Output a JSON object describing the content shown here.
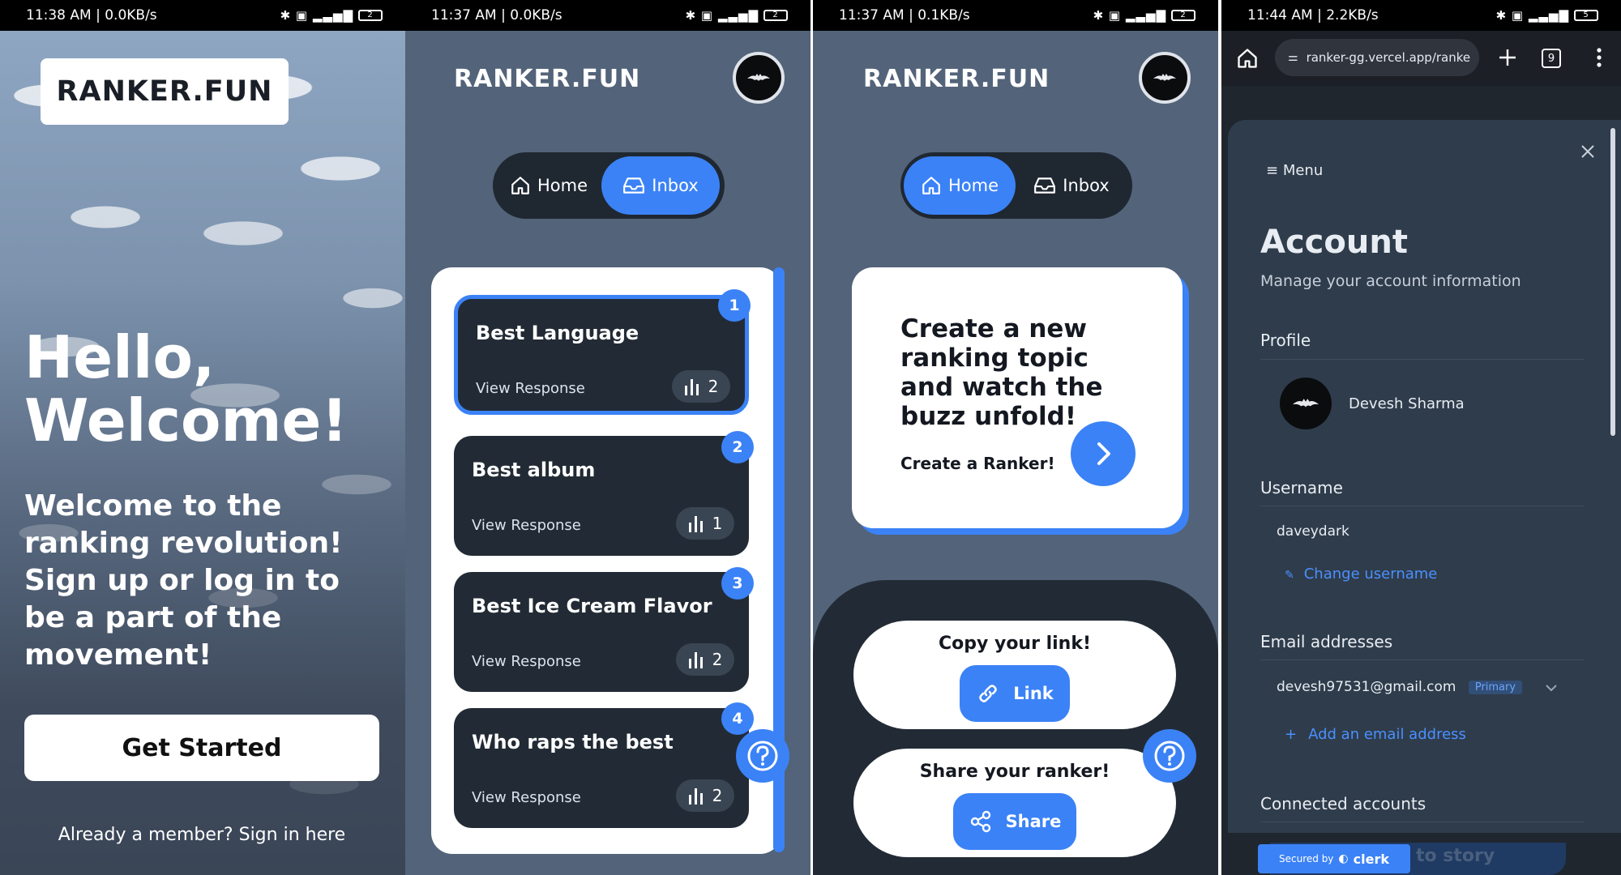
{
  "phone1": {
    "status": {
      "time": "11:38 AM | 0.0KB/s",
      "battery": "2"
    },
    "logo": "RANKER.FUN",
    "greeting": "Hello, Welcome!",
    "subtitle": "Welcome to the ranking revolution! Sign up or log in to be a part of the movement!",
    "cta": "Get Started",
    "signin": "Already a member? Sign in here"
  },
  "phone2": {
    "status": {
      "time": "11:37 AM | 0.0KB/s",
      "battery": "2"
    },
    "brand": "RANKER.FUN",
    "nav": {
      "home": "Home",
      "inbox": "Inbox",
      "active": "inbox"
    },
    "items": [
      {
        "title": "Best Language",
        "view": "View Response",
        "count": "2",
        "badge": "1"
      },
      {
        "title": "Best album",
        "view": "View Response",
        "count": "1",
        "badge": "2"
      },
      {
        "title": "Best Ice Cream Flavor",
        "view": "View Response",
        "count": "2",
        "badge": "3"
      },
      {
        "title": "Who raps the best",
        "view": "View Response",
        "count": "2",
        "badge": "4"
      }
    ]
  },
  "phone3": {
    "status": {
      "time": "11:37 AM | 0.1KB/s",
      "battery": "2"
    },
    "brand": "RANKER.FUN",
    "nav": {
      "home": "Home",
      "inbox": "Inbox",
      "active": "home"
    },
    "create": {
      "text": "Create a new ranking topic and watch the buzz unfold!",
      "cta": "Create a Ranker!"
    },
    "copy": {
      "title": "Copy your link!",
      "button": "Link"
    },
    "share": {
      "title": "Share your ranker!",
      "button": "Share"
    }
  },
  "phone4": {
    "status": {
      "time": "11:44 AM | 2.2KB/s",
      "battery": "5"
    },
    "browser": {
      "url": "ranker-gg.vercel.app/ranke",
      "tabs": "9"
    },
    "menu": "Menu",
    "title": "Account",
    "subtitle": "Manage your account information",
    "profile": {
      "label": "Profile",
      "name": "Devesh Sharma"
    },
    "username": {
      "label": "Username",
      "value": "daveydark",
      "change": "Change username"
    },
    "email": {
      "label": "Email addresses",
      "value": "devesh97531@gmail.com",
      "tag": "Primary",
      "add": "Add an email address"
    },
    "connected": "Connected accounts",
    "footer": {
      "secured": "Secured by",
      "brand": "clerk",
      "behind": "to story"
    }
  },
  "colors": {
    "accent": "#3b82f6",
    "navy": "#222b35",
    "slate": "#536379"
  }
}
